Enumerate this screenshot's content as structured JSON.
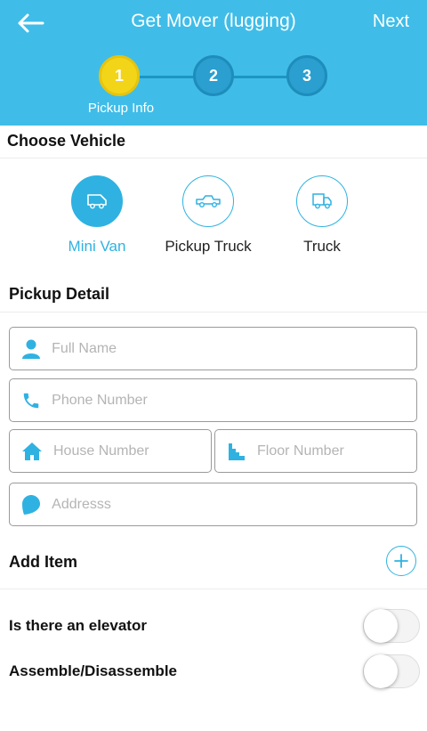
{
  "header": {
    "title": "Get Mover (lugging)",
    "next_label": "Next",
    "back_icon": "arrow-left-icon",
    "background": "#3fbde8"
  },
  "stepper": {
    "steps": [
      {
        "number": "1",
        "state": "active"
      },
      {
        "number": "2",
        "state": "inactive"
      },
      {
        "number": "3",
        "state": "inactive"
      }
    ],
    "active_label": "Pickup Info",
    "active_color": "#f2d518"
  },
  "vehicle_section": {
    "title": "Choose Vehicle",
    "options": [
      {
        "label": "Mini Van",
        "icon": "van-icon",
        "selected": true
      },
      {
        "label": "Pickup Truck",
        "icon": "pickup-truck-icon",
        "selected": false
      },
      {
        "label": "Truck",
        "icon": "truck-icon",
        "selected": false
      }
    ],
    "accent": "#2fb2e1"
  },
  "pickup_section": {
    "title": "Pickup Detail",
    "fields": {
      "full_name": {
        "placeholder": "Full Name",
        "value": "",
        "icon": "person-icon"
      },
      "phone": {
        "placeholder": "Phone Number",
        "value": "",
        "icon": "phone-icon"
      },
      "house": {
        "placeholder": "House Number",
        "value": "",
        "icon": "home-icon"
      },
      "floor": {
        "placeholder": "Floor Number",
        "value": "",
        "icon": "stairs-icon"
      },
      "address": {
        "placeholder": "Addresss",
        "value": "",
        "icon": "location-dot-icon"
      }
    }
  },
  "add_item": {
    "label": "Add Item",
    "icon": "plus-circle-icon"
  },
  "options": [
    {
      "label": "Is there an elevator",
      "enabled": false
    },
    {
      "label": "Assemble/Disassemble",
      "enabled": false
    }
  ]
}
